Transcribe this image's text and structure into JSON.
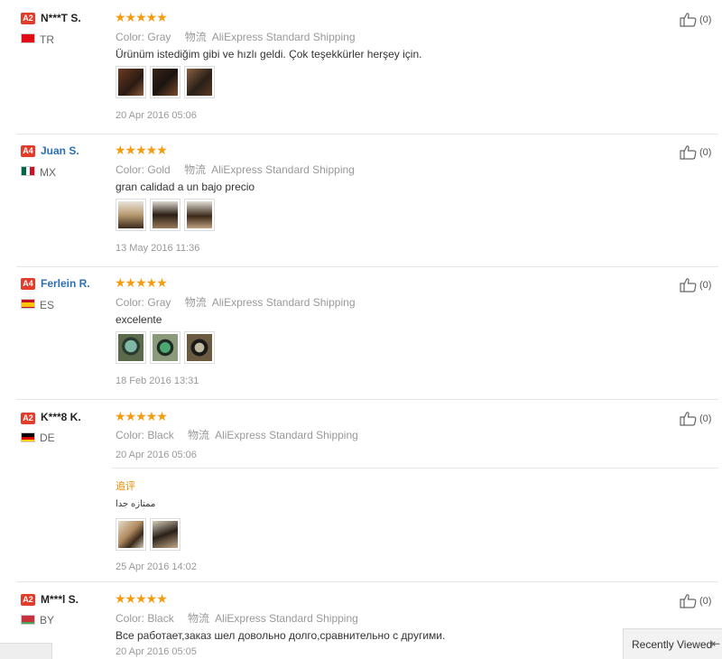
{
  "reviews": [
    {
      "level": "A2",
      "name": "N***T S.",
      "country": "TR",
      "color_label": "Color:",
      "color": "Gray",
      "shipping_label": "物流",
      "shipping": "AliExpress Standard Shipping",
      "text": "Ürünüm istediğim gibi ve hızlı geldi. Çok teşekkürler herşey için.",
      "date": "20 Apr 2016 05:06",
      "helpful": "(0)"
    },
    {
      "level": "A4",
      "name": "Juan S.",
      "country": "MX",
      "color_label": "Color:",
      "color": "Gold",
      "shipping_label": "物流",
      "shipping": "AliExpress Standard Shipping",
      "text": "gran calidad a un bajo precio",
      "date": "13 May 2016 11:36",
      "helpful": "(0)"
    },
    {
      "level": "A4",
      "name": "Ferlein R.",
      "country": "ES",
      "color_label": "Color:",
      "color": "Gray",
      "shipping_label": "物流",
      "shipping": "AliExpress Standard Shipping",
      "text": "excelente",
      "date": "18 Feb 2016 13:31",
      "helpful": "(0)"
    },
    {
      "level": "A2",
      "name": "K***8 K.",
      "country": "DE",
      "color_label": "Color:",
      "color": "Black",
      "shipping_label": "物流",
      "shipping": "AliExpress Standard Shipping",
      "date": "20 Apr 2016 05:06",
      "helpful": "(0)",
      "followup_label": "追评",
      "followup_text": "ممتازه جدا",
      "followup_date": "25 Apr 2016 14:02"
    },
    {
      "level": "A2",
      "name": "M***l S.",
      "country": "BY",
      "color_label": "Color:",
      "color": "Black",
      "shipping_label": "物流",
      "shipping": "AliExpress Standard Shipping",
      "text": "Все работает,заказ шел довольно долго,сравнительно с другими.",
      "date": "20 Apr 2016 05:05",
      "helpful": "(0)"
    }
  ],
  "stars": "★★★★★",
  "recently_viewed": "Recently Viewed",
  "colors": {
    "star": "#f39c12",
    "badge": "#e23c2b",
    "link": "#2d6fb6",
    "followup": "#e88b00"
  }
}
